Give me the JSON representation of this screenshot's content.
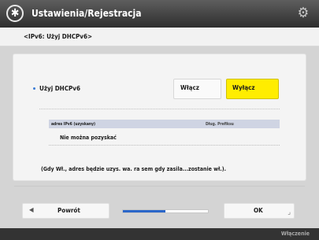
{
  "header": {
    "title": "Ustawienia/Rejestracja",
    "app_icon": "asterisk-circle-icon",
    "right_icon": "settings-gear-icon"
  },
  "subheader": {
    "label": "<IPv6: Użyj DHCPv6>"
  },
  "option": {
    "label": "Użyj DHCPv6",
    "on_label": "Włącz",
    "off_label": "Wyłącz",
    "selected": "Wyłącz"
  },
  "table": {
    "header_left": "adres IPv6 (uzyskany)",
    "header_right": "Dług. Prefiksu",
    "row_text": "Nie można pozyskać"
  },
  "note": "(Gdy Wł., adres będzie uzys. wa. ra sem gdy zasila...zostanie wł.).",
  "footer_nav": {
    "back_label": "Powrót",
    "back_icon": "triangle-left-icon",
    "ok_label": "OK",
    "progress_fraction": 0.5
  },
  "footer": {
    "text": "Włączenie"
  },
  "colors": {
    "accent_selected": "#ffed00",
    "progress": "#2b67c9",
    "header_bg": "#3c3c3c"
  }
}
